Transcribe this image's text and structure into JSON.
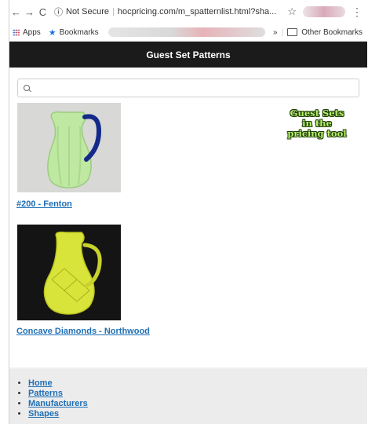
{
  "browser": {
    "back_glyph": "←",
    "forward_glyph": "→",
    "reload_glyph": "C",
    "security_label": "Not Secure",
    "url": "hocpricing.com/m_spatternlist.html?sha...",
    "star_glyph": "☆",
    "menu_glyph": "⋮"
  },
  "bookmarks": {
    "apps_label": "Apps",
    "bookmarks_label": "Bookmarks",
    "overflow_glyph": "»",
    "other_label": "Other Bookmarks"
  },
  "header": {
    "title": "Guest Set Patterns"
  },
  "search": {
    "placeholder": "",
    "value": ""
  },
  "patterns": [
    {
      "label": "#200 - Fenton"
    },
    {
      "label": "Concave Diamonds - Northwood"
    }
  ],
  "promo": {
    "line1": "Guest Sets",
    "line2": "in the",
    "line3": "pricing tool"
  },
  "footer": {
    "links": [
      {
        "label": "Home"
      },
      {
        "label": "Patterns"
      },
      {
        "label": "Manufacturers"
      },
      {
        "label": "Shapes"
      }
    ]
  },
  "colors": {
    "header_bg": "#1b1b1b",
    "link": "#1f6fb5",
    "promo_fill": "#b8f26a",
    "promo_outline": "#1d3a0a"
  }
}
